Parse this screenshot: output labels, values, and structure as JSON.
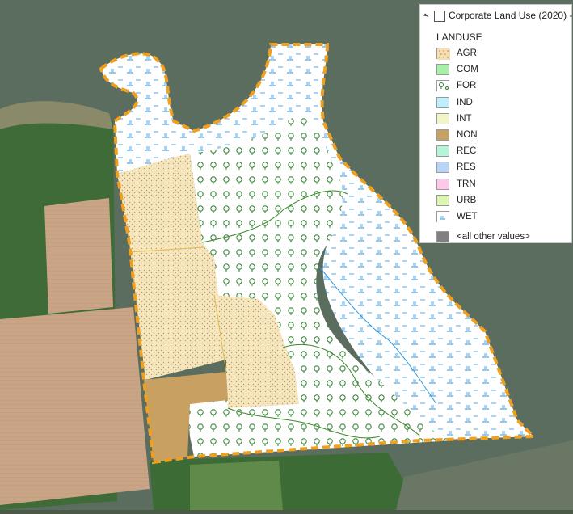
{
  "layer": {
    "title": "Corporate Land Use (2020) -",
    "visible_checked": false
  },
  "legend": {
    "field": "LANDUSE",
    "items": [
      {
        "code": "AGR",
        "color": "#f5deb3",
        "pattern": "dots",
        "icon": "dot-stipple-swatch"
      },
      {
        "code": "COM",
        "color": "#a8f0a8",
        "pattern": "solid",
        "icon": "solid-swatch"
      },
      {
        "code": "FOR",
        "color": "#ffffff",
        "pattern": "trees",
        "icon": "tree-swatch"
      },
      {
        "code": "IND",
        "color": "#bfeeff",
        "pattern": "solid",
        "icon": "solid-swatch"
      },
      {
        "code": "INT",
        "color": "#f2f5c4",
        "pattern": "solid",
        "icon": "solid-swatch"
      },
      {
        "code": "NON",
        "color": "#c8a064",
        "pattern": "solid",
        "icon": "solid-swatch"
      },
      {
        "code": "REC",
        "color": "#b4f5d8",
        "pattern": "solid",
        "icon": "solid-swatch"
      },
      {
        "code": "RES",
        "color": "#b8d4f8",
        "pattern": "solid",
        "icon": "solid-swatch"
      },
      {
        "code": "TRN",
        "color": "#ffc8e8",
        "pattern": "solid",
        "icon": "solid-swatch"
      },
      {
        "code": "URB",
        "color": "#dcf5b0",
        "pattern": "solid",
        "icon": "solid-swatch"
      },
      {
        "code": "WET",
        "color": "#ffffff",
        "pattern": "marsh",
        "icon": "marsh-swatch"
      }
    ],
    "other": {
      "label": "<all other values>",
      "color": "#808080"
    }
  },
  "map": {
    "boundary_color": "#f0a020",
    "water_color": "#5a6f5c",
    "field_color": "#c9a585",
    "forest_line_color": "#3a8a2a",
    "wetland_line_color": "#3a9ad8"
  }
}
